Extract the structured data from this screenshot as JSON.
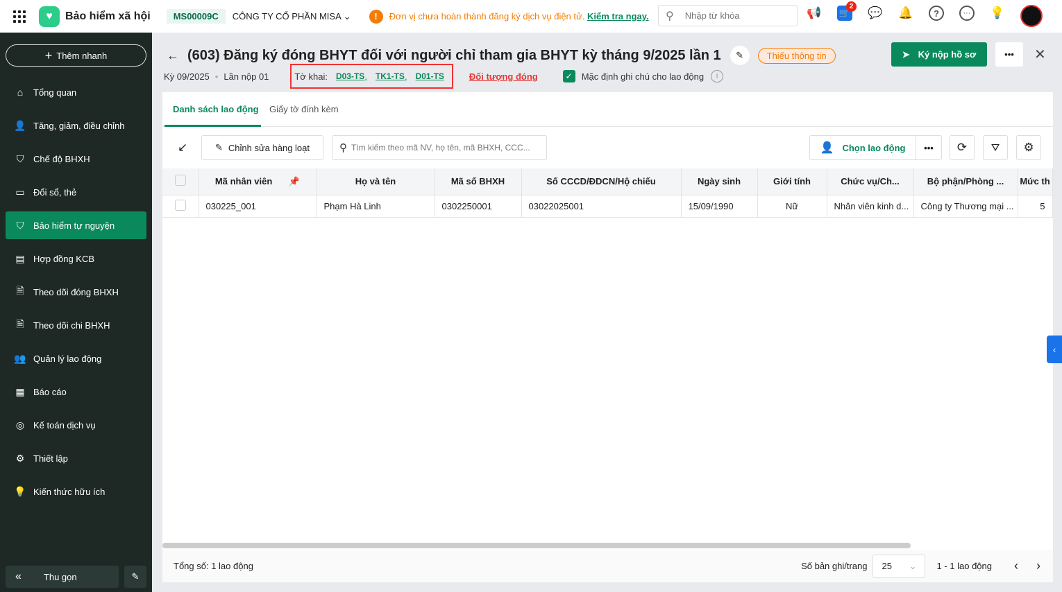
{
  "header": {
    "app_name": "Bảo hiểm xã hội",
    "company_code": "MS00009C",
    "company_name": "CÔNG TY CỔ PHẦN MISA",
    "warning": "Đơn vị chưa hoàn thành đăng ký dịch vụ điện tử.",
    "warning_link": "Kiểm tra ngay.",
    "search_placeholder": "Nhập từ khóa",
    "cart_badge": "2"
  },
  "sidebar": {
    "quick_add": "Thêm nhanh",
    "items": [
      {
        "label": "Tổng quan",
        "icon": "home-icon"
      },
      {
        "label": "Tăng, giảm, điều chỉnh",
        "icon": "user-icon"
      },
      {
        "label": "Chế độ BHXH",
        "icon": "shield-icon"
      },
      {
        "label": "Đổi sổ, thẻ",
        "icon": "card-icon"
      },
      {
        "label": "Bảo hiểm tự nguyện",
        "icon": "shield-check-icon",
        "active": true
      },
      {
        "label": "Hợp đồng KCB",
        "icon": "contract-icon"
      },
      {
        "label": "Theo dõi đóng BHXH",
        "icon": "doc-icon"
      },
      {
        "label": "Theo dõi chi BHXH",
        "icon": "doc-icon"
      },
      {
        "label": "Quản lý lao động",
        "icon": "users-icon"
      },
      {
        "label": "Báo cáo",
        "icon": "report-icon"
      },
      {
        "label": "Kế toán dịch vụ",
        "icon": "accounting-icon"
      },
      {
        "label": "Thiết lập",
        "icon": "gear-icon"
      },
      {
        "label": "Kiến thức hữu ích",
        "icon": "lightbulb-icon"
      }
    ],
    "collapse": "Thu gọn"
  },
  "page": {
    "title": "(603) Đăng ký đóng BHYT đối với người chỉ tham gia BHYT kỳ tháng 9/2025 lần 1",
    "status": "Thiếu thông tin",
    "submit": "Ký nộp hồ sơ",
    "period": "Kỳ 09/2025",
    "attempt": "Lần nộp 01",
    "forms_label": "Tờ khai:",
    "forms": [
      "D03-TS",
      "TK1-TS",
      "D01-TS"
    ],
    "subject_link": "Đối tượng đóng",
    "default_note": "Mặc định ghi chú cho lao động",
    "default_note_checked": true
  },
  "tabs": [
    {
      "label": "Danh sách lao động",
      "active": true
    },
    {
      "label": "Giấy tờ đính kèm"
    }
  ],
  "toolbar": {
    "bulk_edit": "Chỉnh sửa hàng loạt",
    "search_placeholder": "Tìm kiếm theo mã NV, họ tên, mã BHXH, CCC...",
    "choose": "Chọn lao động"
  },
  "table": {
    "columns": [
      "Mã nhân viên",
      "Họ và tên",
      "Mã số BHXH",
      "Số CCCD/ĐDCN/Hộ chiếu",
      "Ngày sinh",
      "Giới tính",
      "Chức vụ/Ch...",
      "Bộ phận/Phòng ...",
      "Mức th"
    ],
    "rows": [
      [
        "030225_001",
        "Phạm Hà Linh",
        "0302250001",
        "03022025001",
        "15/09/1990",
        "Nữ",
        "Nhân viên kinh d...",
        "Công ty Thương mại ...",
        "5"
      ]
    ]
  },
  "footer": {
    "total": "Tổng số: 1 lao động",
    "per_page_label": "Số bản ghi/trang",
    "per_page": "25",
    "range": "1 - 1 lao động"
  },
  "colors": {
    "primary": "#0a8a5c",
    "sidebar": "#1e2926",
    "warning": "#f57c00",
    "highlight": "#e33333"
  }
}
